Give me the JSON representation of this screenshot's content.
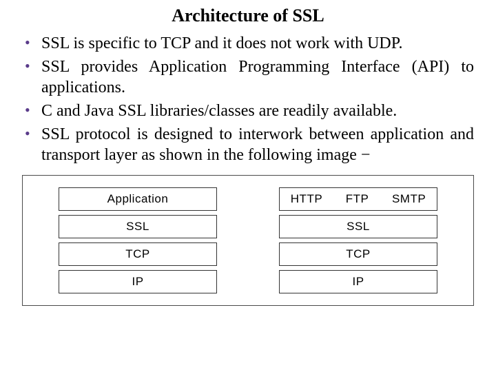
{
  "title": "Architecture of SSL",
  "bullets": [
    "SSL is specific to TCP and it does not work with UDP.",
    "SSL provides Application Programming Interface (API) to applications.",
    "C and Java SSL libraries/classes are readily available.",
    "SSL protocol is designed to interwork between application and transport layer as shown in the following image −"
  ],
  "diagram": {
    "left_stack": [
      "Application",
      "SSL",
      "TCP",
      "IP"
    ],
    "right_stack": {
      "top_row": [
        "HTTP",
        "FTP",
        "SMTP"
      ],
      "rest": [
        "SSL",
        "TCP",
        "IP"
      ]
    }
  }
}
